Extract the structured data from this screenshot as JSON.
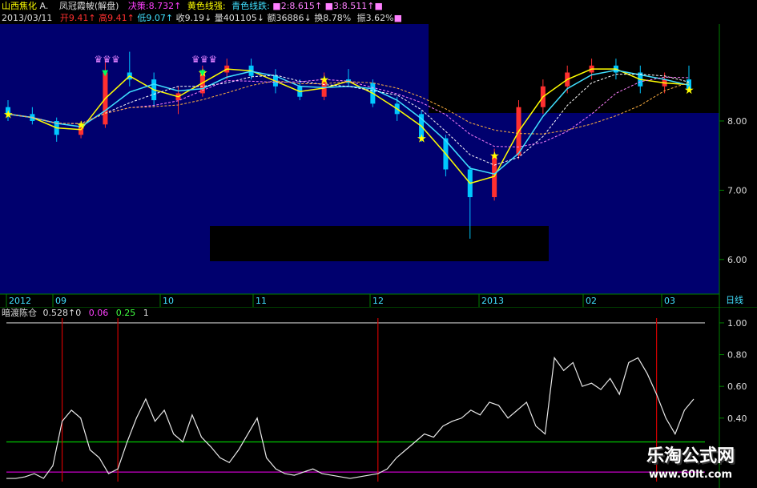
{
  "header": {
    "stock_name": "山西焦化",
    "stock_suffix": "A.",
    "indicator_name": "凤冠霞帔(解盘)",
    "decision_label": "决策:",
    "decision_value": "8.732",
    "yellow_label": "黄色线强:",
    "cyan_label": "青色线跌:",
    "m2_label": "■2:",
    "m2_value": "8.615",
    "m3_label": "■3:",
    "m3_value": "8.511",
    "date": "2013/03/11",
    "open_label": "开",
    "open_value": "9.41",
    "high_label": "高",
    "high_value": "9.41",
    "low_label": "低",
    "low_value": "9.07",
    "close_label": "收",
    "close_value": "9.19",
    "volume_label": "量",
    "volume_value": "401105",
    "amount_label": "额",
    "amount_value": "36886",
    "turnover_label": "换",
    "turnover_value": "8.78%",
    "amplitude_label": "振",
    "amplitude_value": "3.62%"
  },
  "sub_header": {
    "indicator_name": "暗渡陈仓",
    "v1": "0.528",
    "v2": "0",
    "v3": "0.06",
    "v4": "0.25",
    "v5": "1"
  },
  "period_label": "日线",
  "watermark": {
    "text": "乐淘公式网",
    "url": "www.60lt.com"
  },
  "colors": {
    "bg_main": "#00006e",
    "up_candle": "#ff3030",
    "down_candle": "#00c8ff",
    "yellow_line": "#ffff00",
    "cyan_line": "#40e0ff",
    "green_line": "#00c800",
    "magenta_line": "#c800c8",
    "grid_green": "#008000"
  },
  "chart_data": [
    {
      "type": "candlestick",
      "title": "",
      "x_tick_labels": [
        "2012",
        "09",
        "10",
        "11",
        "12",
        "2013",
        "02",
        "03"
      ],
      "y_ticks": [
        "8.00",
        "7.00",
        "6.00"
      ],
      "ylim": [
        5.5,
        9.4
      ],
      "ohlc_sample": [
        [
          8.2,
          8.3,
          8.0,
          8.1
        ],
        [
          8.1,
          8.2,
          7.95,
          8.0
        ],
        [
          8.0,
          8.05,
          7.7,
          7.8
        ],
        [
          7.8,
          8.0,
          7.75,
          7.95
        ],
        [
          7.95,
          8.9,
          7.9,
          8.7
        ],
        [
          8.7,
          9.0,
          8.5,
          8.6
        ],
        [
          8.6,
          8.7,
          8.2,
          8.3
        ],
        [
          8.3,
          8.5,
          8.1,
          8.4
        ],
        [
          8.4,
          8.8,
          8.35,
          8.7
        ],
        [
          8.7,
          8.9,
          8.6,
          8.8
        ],
        [
          8.8,
          8.9,
          8.6,
          8.65
        ],
        [
          8.65,
          8.75,
          8.4,
          8.5
        ],
        [
          8.5,
          8.6,
          8.3,
          8.35
        ],
        [
          8.35,
          8.7,
          8.3,
          8.6
        ],
        [
          8.6,
          8.75,
          8.5,
          8.55
        ],
        [
          8.55,
          8.6,
          8.2,
          8.25
        ],
        [
          8.25,
          8.35,
          8.0,
          8.1
        ],
        [
          8.1,
          8.15,
          7.7,
          7.75
        ],
        [
          7.75,
          7.8,
          7.2,
          7.3
        ],
        [
          7.3,
          7.35,
          6.3,
          6.9
        ],
        [
          6.9,
          7.6,
          6.85,
          7.5
        ],
        [
          7.5,
          8.3,
          7.45,
          8.2
        ],
        [
          8.2,
          8.6,
          8.1,
          8.5
        ],
        [
          8.5,
          8.8,
          8.4,
          8.7
        ],
        [
          8.7,
          8.9,
          8.6,
          8.8
        ],
        [
          8.8,
          8.9,
          8.6,
          8.7
        ],
        [
          8.7,
          8.8,
          8.4,
          8.5
        ],
        [
          8.5,
          8.7,
          8.4,
          8.6
        ],
        [
          8.6,
          8.8,
          8.5,
          8.45
        ]
      ]
    },
    {
      "type": "line",
      "title": "",
      "y_ticks": [
        "1.00",
        "0.80",
        "0.60",
        "0.40"
      ],
      "ylim": [
        0.0,
        1.03
      ],
      "series": [
        {
          "values": [
            0.02,
            0.02,
            0.03,
            0.05,
            0.02,
            0.1,
            0.38,
            0.45,
            0.4,
            0.2,
            0.15,
            0.05,
            0.08,
            0.25,
            0.4,
            0.52,
            0.38,
            0.45,
            0.3,
            0.25,
            0.42,
            0.28,
            0.22,
            0.15,
            0.12,
            0.2,
            0.3,
            0.4,
            0.15,
            0.08,
            0.05,
            0.04,
            0.06,
            0.08,
            0.05,
            0.04,
            0.03,
            0.02,
            0.03,
            0.04,
            0.05,
            0.08,
            0.15,
            0.2,
            0.25,
            0.3,
            0.28,
            0.35,
            0.38,
            0.4,
            0.45,
            0.42,
            0.5,
            0.48,
            0.4,
            0.45,
            0.5,
            0.35,
            0.3,
            0.78,
            0.7,
            0.75,
            0.6,
            0.62,
            0.58,
            0.65,
            0.55,
            0.75,
            0.78,
            0.68,
            0.55,
            0.4,
            0.3,
            0.45,
            0.52
          ]
        }
      ],
      "h_lines": [
        1.0,
        0.25,
        0.06
      ],
      "vertical_signals_index": [
        6,
        12,
        40,
        70
      ]
    }
  ]
}
